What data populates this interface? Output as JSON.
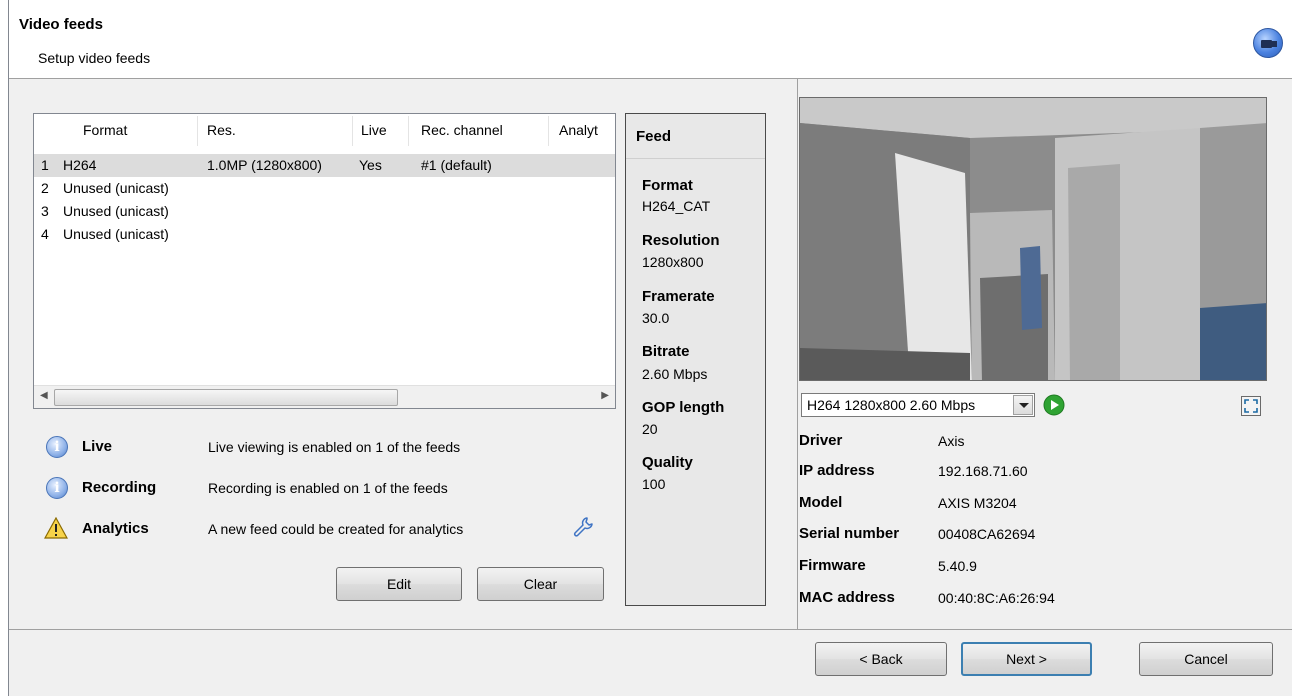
{
  "header": {
    "title": "Video feeds",
    "subtitle": "Setup video feeds",
    "icon": "camera-icon"
  },
  "feed_list": {
    "columns": [
      "Format",
      "Res.",
      "Live",
      "Rec. channel",
      "Analyt"
    ],
    "rows": [
      {
        "num": "1",
        "format": "H264",
        "res": "1.0MP (1280x800)",
        "live": "Yes",
        "rec": "#1 (default)"
      },
      {
        "num": "2",
        "format": "Unused (unicast)",
        "res": "",
        "live": "",
        "rec": ""
      },
      {
        "num": "3",
        "format": "Unused (unicast)",
        "res": "",
        "live": "",
        "rec": ""
      },
      {
        "num": "4",
        "format": "Unused (unicast)",
        "res": "",
        "live": "",
        "rec": ""
      }
    ]
  },
  "feed_panel": {
    "title": "Feed",
    "format_label": "Format",
    "format_value": "H264_CAT",
    "resolution_label": "Resolution",
    "resolution_value": "1280x800",
    "framerate_label": "Framerate",
    "framerate_value": "30.0",
    "bitrate_label": "Bitrate",
    "bitrate_value": "2.60 Mbps",
    "gop_label": "GOP length",
    "gop_value": "20",
    "quality_label": "Quality",
    "quality_value": "100"
  },
  "status": {
    "live_label": "Live",
    "live_text": "Live viewing is enabled on 1 of the feeds",
    "recording_label": "Recording",
    "recording_text": "Recording is enabled on 1 of the feeds",
    "analytics_label": "Analytics",
    "analytics_text": "A new feed could be created for analytics"
  },
  "buttons": {
    "edit": "Edit",
    "clear": "Clear",
    "back": "< Back",
    "next": "Next >",
    "cancel": "Cancel"
  },
  "preview": {
    "stream_select": "H264 1280x800 2.60 Mbps"
  },
  "device": {
    "driver_label": "Driver",
    "driver": "Axis",
    "ip_label": "IP address",
    "ip": "192.168.71.60",
    "model_label": "Model",
    "model": "AXIS M3204",
    "serial_label": "Serial number",
    "serial": "00408CA62694",
    "firmware_label": "Firmware",
    "firmware": "5.40.9",
    "mac_label": "MAC address",
    "mac": "00:40:8C:A6:26:94"
  }
}
